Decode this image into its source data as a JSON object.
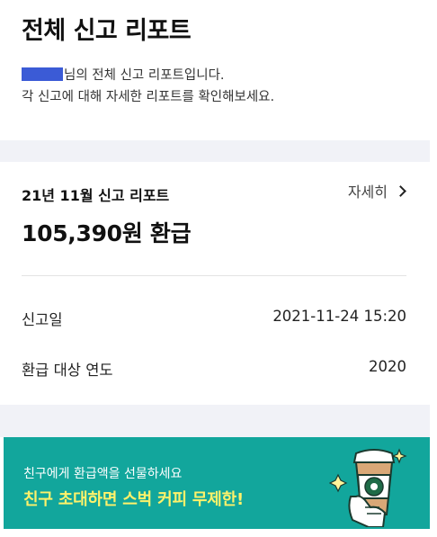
{
  "header": {
    "title": "전체 신고 리포트",
    "subtitle_line1": "님의 전체 신고 리포트입니다.",
    "subtitle_line2": "각 신고에 대해 자세한 리포트를 확인해보세요."
  },
  "report_card": {
    "month_title": "21년 11월 신고 리포트",
    "detail_link": "자세히",
    "refund_amount": "105,390원 환급",
    "rows": [
      {
        "label": "신고일",
        "value": "2021-11-24 15:20"
      },
      {
        "label": "환급 대상 연도",
        "value": "2020"
      }
    ]
  },
  "banner": {
    "subtitle": "친구에게 환급액을 선물하세요",
    "headline": "친구 초대하면 스벅 커피 무제한!",
    "icon": "coffee-cup-icon"
  },
  "colors": {
    "banner_bg": "#12a69c",
    "banner_headline": "#fff26a",
    "redaction": "#3b5bd6",
    "band": "#f1f2f7"
  }
}
